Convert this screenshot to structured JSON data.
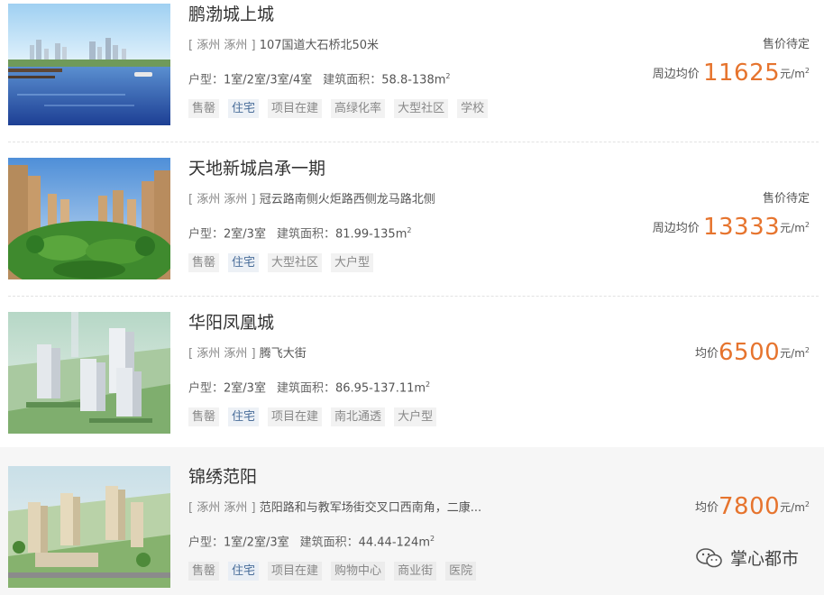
{
  "listings": [
    {
      "name": "鹏渤城上城",
      "location": "[ 涿州 涿州 ]",
      "address": "107国道大石桥北50米",
      "layout_label": "户型：",
      "layout": "1室/2室/3室/4室",
      "area_label": "建筑面积：",
      "area": "58.8-138m",
      "area_sup": "2",
      "tags": [
        "售罄",
        "住宅",
        "项目在建",
        "高绿化率",
        "大型社区",
        "学校"
      ],
      "status": "售价待定",
      "price_label": "周边均价",
      "price": "11625",
      "price_unit": "元/m",
      "price_unit_sup": "2"
    },
    {
      "name": "天地新城启承一期",
      "location": "[ 涿州 涿州 ]",
      "address": "冠云路南侧火炬路西侧龙马路北侧",
      "layout_label": "户型：",
      "layout": "2室/3室",
      "area_label": "建筑面积：",
      "area": "81.99-135m",
      "area_sup": "2",
      "tags": [
        "售罄",
        "住宅",
        "大型社区",
        "大户型"
      ],
      "status": "售价待定",
      "price_label": "周边均价",
      "price": "13333",
      "price_unit": "元/m",
      "price_unit_sup": "2"
    },
    {
      "name": "华阳凤凰城",
      "location": "[ 涿州 涿州 ]",
      "address": "腾飞大街",
      "layout_label": "户型：",
      "layout": "2室/3室",
      "area_label": "建筑面积：",
      "area": "86.95-137.11m",
      "area_sup": "2",
      "tags": [
        "售罄",
        "住宅",
        "项目在建",
        "南北通透",
        "大户型"
      ],
      "status": "",
      "price_label": "均价",
      "price": "6500",
      "price_unit": "元/m",
      "price_unit_sup": "2"
    },
    {
      "name": "锦绣范阳",
      "location": "[ 涿州 涿州 ]",
      "address": "范阳路和与教军场街交叉口西南角，二康...",
      "layout_label": "户型：",
      "layout": "1室/2室/3室",
      "area_label": "建筑面积：",
      "area": "44.44-124m",
      "area_sup": "2",
      "tags": [
        "售罄",
        "住宅",
        "项目在建",
        "购物中心",
        "商业街",
        "医院"
      ],
      "status": "",
      "price_label": "均价",
      "price": "7800",
      "price_unit": "元/m",
      "price_unit_sup": "2"
    }
  ],
  "watermark": "掌心都市",
  "colors": {
    "accent_price": "#e6742e",
    "tag_home_text": "#4a6e9a",
    "tag_text": "#888888"
  }
}
